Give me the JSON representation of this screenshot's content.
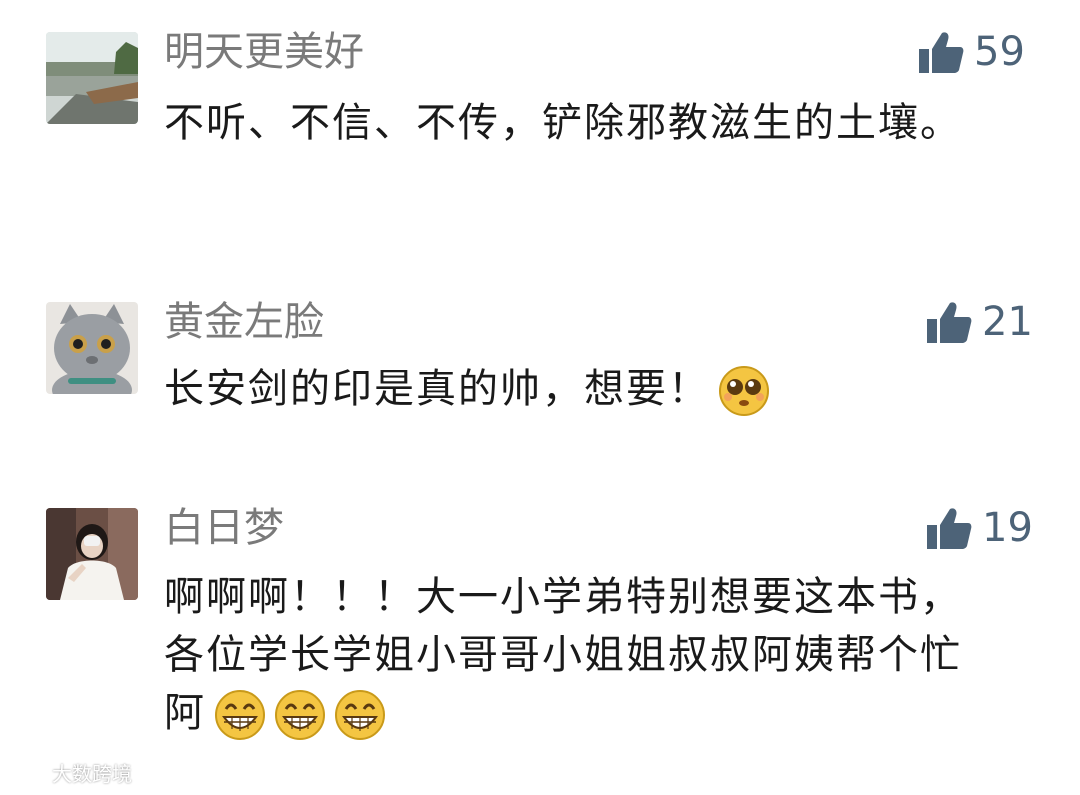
{
  "comments": [
    {
      "name": "明天更美好",
      "text": "不听、不信、不传，铲除邪教滋生的土壤。",
      "likes": "59",
      "avatar_icon": "landscape-photo-avatar"
    },
    {
      "name": "黄金左脸",
      "text": "长安剑的印是真的帅，想要！",
      "likes": "21",
      "avatar_icon": "gray-cat-avatar",
      "emoji": [
        "pleading-face-emoji"
      ]
    },
    {
      "name": "白日梦",
      "text": "啊啊啊！！！大一小学弟特别想要这本书，各位学长学姐小哥哥小姐姐叔叔阿姨帮个忙阿",
      "likes": "19",
      "avatar_icon": "girl-photo-avatar",
      "emoji": [
        "grinning-face-emoji",
        "grinning-face-emoji",
        "grinning-face-emoji"
      ]
    }
  ],
  "watermark": {
    "text": "大数跨境",
    "icon": "weibo-logo-icon"
  },
  "colors": {
    "name": "#7a7a7a",
    "text": "#1a1a1a",
    "like": "#4d6378"
  }
}
